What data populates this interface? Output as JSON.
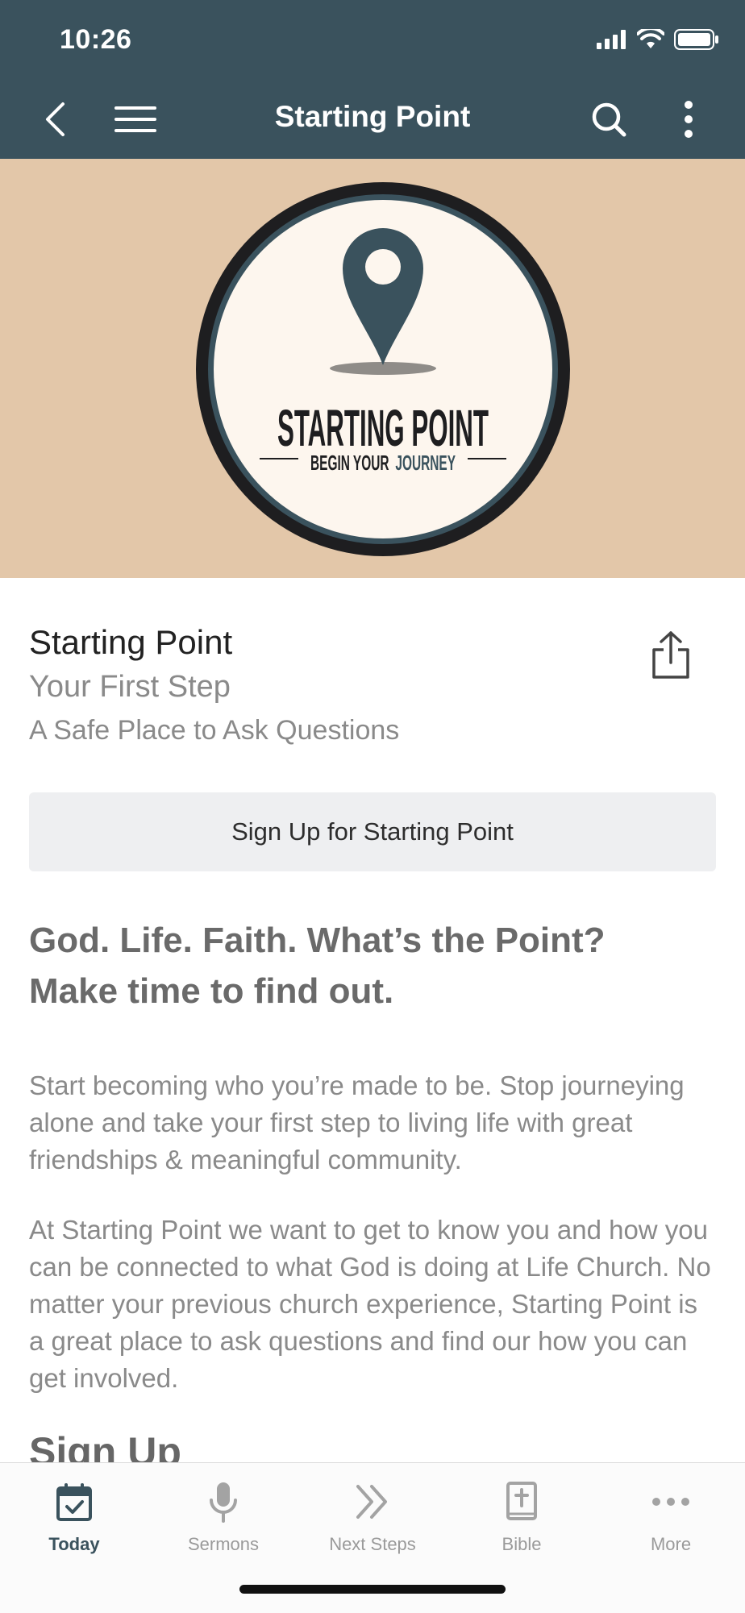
{
  "status": {
    "time": "10:26"
  },
  "nav": {
    "title": "Starting Point",
    "back_icon": "chevron-left-icon",
    "menu_icon": "hamburger-icon",
    "search_icon": "search-icon",
    "more_icon": "vertical-dots-icon"
  },
  "hero": {
    "logo_title": "STARTING POINT",
    "logo_sub_a": "BEGIN YOUR",
    "logo_sub_b": "JOURNEY",
    "background": "#e3c7a9"
  },
  "detail": {
    "title": "Starting Point",
    "subtitle": "Your First Step",
    "tagline": "A Safe Place to Ask Questions"
  },
  "signup_button": "Sign Up for Starting Point",
  "content": {
    "heading_line1": "God. Life. Faith. What’s the Point?",
    "heading_line2": "Make time to find out.",
    "para1": "Start becoming who you’re made to be. Stop journeying alone and take your first step to living life with great friendships & meaningful community.",
    "para2": "At Starting Point we want to get to know you and how you can be connected to what God is doing at Life Church. No matter your previous church experience, Starting Point is a great place to ask questions and find our how you can get involved.",
    "signup_heading": "Sign Up"
  },
  "tabs": [
    {
      "label": "Today",
      "icon": "calendar-check-icon",
      "active": true
    },
    {
      "label": "Sermons",
      "icon": "microphone-icon",
      "active": false
    },
    {
      "label": "Next Steps",
      "icon": "double-chevron-right-icon",
      "active": false
    },
    {
      "label": "Bible",
      "icon": "bible-icon",
      "active": false
    },
    {
      "label": "More",
      "icon": "more-dots-icon",
      "active": false
    }
  ],
  "colors": {
    "accent": "#3a525d",
    "text_muted": "#8a8a8a"
  }
}
